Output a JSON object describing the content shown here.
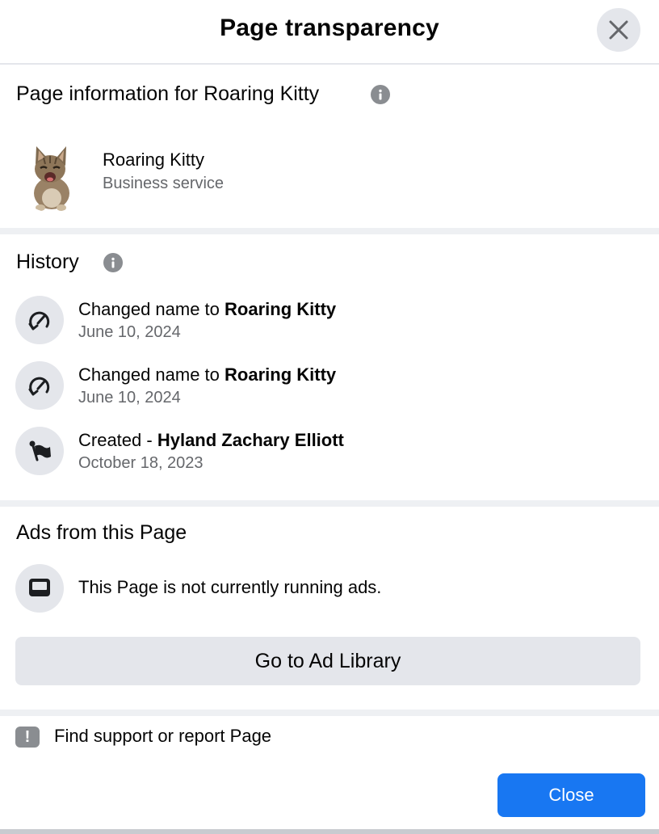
{
  "header": {
    "title": "Page transparency",
    "close_icon": "close-icon"
  },
  "page_info": {
    "title": "Page information for Roaring Kitty",
    "page_name": "Roaring Kitty",
    "category": "Business service"
  },
  "history": {
    "title": "History",
    "items": [
      {
        "prefix": "Changed name to ",
        "emphasis": "Roaring Kitty",
        "date": "June 10, 2024",
        "icon": "name-change-icon"
      },
      {
        "prefix": "Changed name to ",
        "emphasis": "Roaring Kitty",
        "date": "June 10, 2024",
        "icon": "name-change-icon"
      },
      {
        "prefix": "Created - ",
        "emphasis": "Hyland Zachary Elliott",
        "date": "October 18, 2023",
        "icon": "flag-icon"
      }
    ]
  },
  "ads": {
    "title": "Ads from this Page",
    "status_text": "This Page is not currently running ads.",
    "button_label": "Go to Ad Library"
  },
  "support": {
    "label": "Find support or report Page"
  },
  "footer": {
    "close_label": "Close",
    "accent_color": "#1877f2"
  }
}
